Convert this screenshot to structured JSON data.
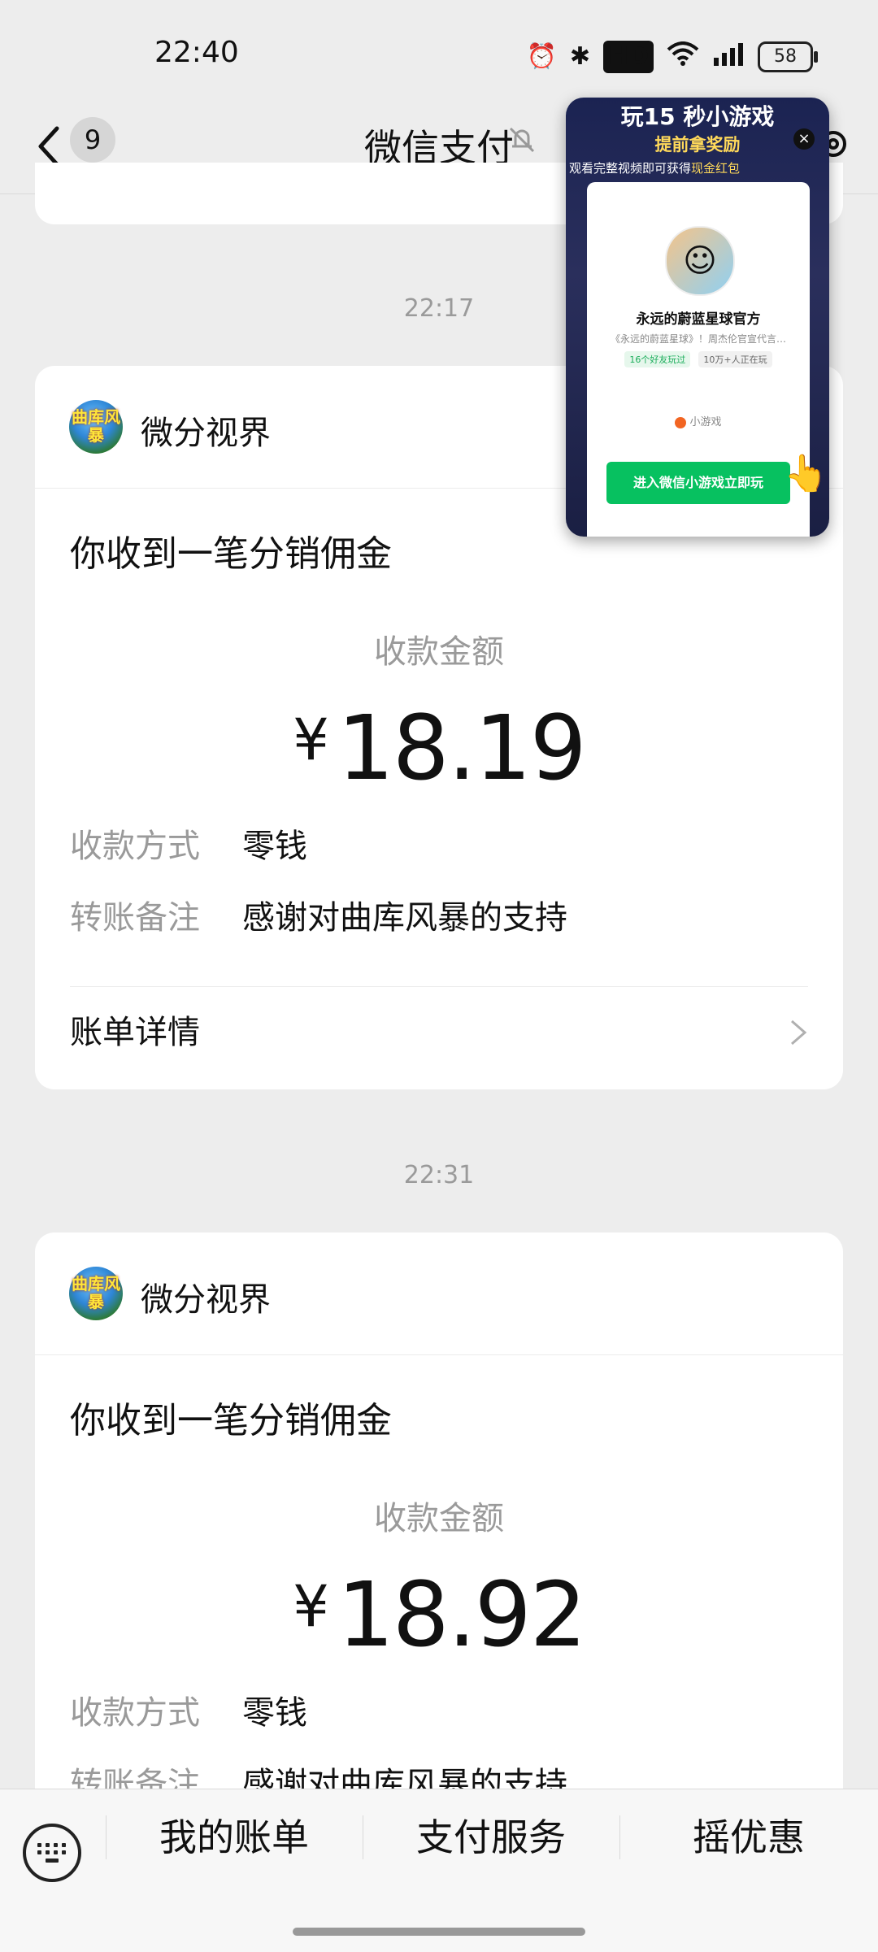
{
  "status_bar": {
    "time": "22:40",
    "battery": "58"
  },
  "nav": {
    "badge": "9",
    "title": "微信支付"
  },
  "ad": {
    "title": "玩15 秒小游戏",
    "subtitle": "提前拿奖励",
    "hint_prefix": "观看完整视频即可获得",
    "hint_highlight": "现金红包",
    "close": "×",
    "game_name": "永远的蔚蓝星球官方",
    "game_desc": "《永远的蔚蓝星球》！周杰伦官宣代言…",
    "tag_friends": "16个好友玩过",
    "tag_players": "10万+人正在玩",
    "mini_label": "小游戏",
    "button": "进入微信小游戏立即玩"
  },
  "messages": [
    {
      "time": "22:17",
      "sender": "微分视界",
      "avatar_text": "曲库风暴",
      "title": "你收到一笔分销佣金",
      "amount_label": "收款金额",
      "currency": "¥",
      "amount": "18.19",
      "method_label": "收款方式",
      "method": "零钱",
      "note_label": "转账备注",
      "note": "感谢对曲库风暴的支持",
      "detail": "账单详情"
    },
    {
      "time": "22:31",
      "sender": "微分视界",
      "avatar_text": "曲库风暴",
      "title": "你收到一笔分销佣金",
      "amount_label": "收款金额",
      "currency": "¥",
      "amount": "18.92",
      "method_label": "收款方式",
      "method": "零钱",
      "note_label": "转账备注",
      "note": "感谢对曲库风暴的支持"
    }
  ],
  "tabs": [
    "我的账单",
    "支付服务",
    "摇优惠"
  ]
}
